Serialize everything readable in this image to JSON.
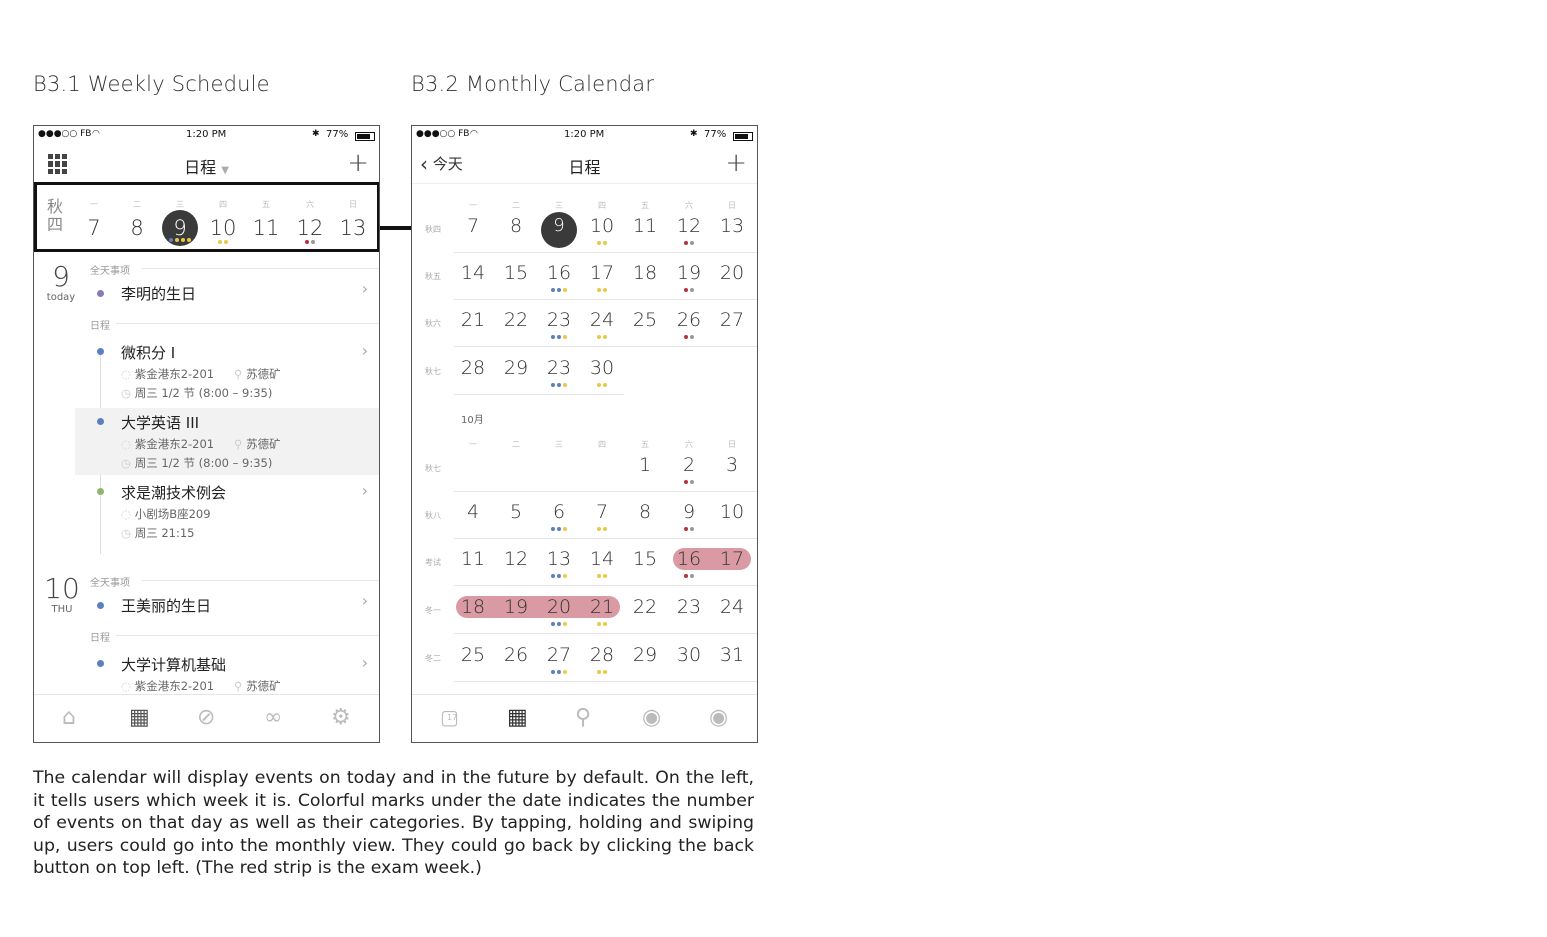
{
  "titles": {
    "left": "B3.1 Weekly Schedule",
    "right": "B3.2 Monthly Calendar"
  },
  "status": {
    "carrier": "●●●○○ FB",
    "time": "1:20 PM",
    "battery": "77%"
  },
  "colors": {
    "purple": "#8a7bb5",
    "blue": "#5b7fbf",
    "green": "#8fb56b",
    "yellow": "#e8c94a",
    "red": "#b5323c",
    "gray": "#999999",
    "exam": "#d99aa3",
    "today": "#3a3a3a"
  },
  "weekly": {
    "nav": {
      "title": "日程",
      "menu_icon": "grid-icon",
      "add": "+",
      "dropdown": "▼"
    },
    "week_label": [
      "秋",
      "四"
    ],
    "weekday_heads": [
      "一",
      "二",
      "三",
      "四",
      "五",
      "六",
      "日"
    ],
    "days": [
      {
        "num": "7",
        "dots": []
      },
      {
        "num": "8",
        "dots": []
      },
      {
        "num": "9",
        "dots": [
          "blue",
          "yellow",
          "yellow",
          "yellow"
        ],
        "today": true
      },
      {
        "num": "10",
        "dots": [
          "yellow",
          "yellow"
        ]
      },
      {
        "num": "11",
        "dots": []
      },
      {
        "num": "12",
        "dots": [
          "red",
          "gray"
        ]
      },
      {
        "num": "13",
        "dots": []
      }
    ],
    "day1": {
      "num": "9",
      "sub": "today",
      "allday_label": "全天事项",
      "allday_event": "李明的生日",
      "schedule_label": "日程",
      "events": [
        {
          "title": "微积分 I",
          "place": "紫金港东2-201",
          "person": "苏德矿",
          "time": "周三 1/2 节 (8:00 – 9:35)"
        },
        {
          "title": "大学英语 III",
          "place": "紫金港东2-201",
          "person": "苏德矿",
          "time": "周三 1/2 节 (8:00 – 9:35)"
        },
        {
          "title": "求是潮技术例会",
          "place": "小剧场B座209",
          "time": "周三 21:15"
        }
      ]
    },
    "day2": {
      "num": "10",
      "sub": "THU",
      "allday_label": "全天事项",
      "allday_event": "王美丽的生日",
      "schedule_label": "日程",
      "events": [
        {
          "title": "大学计算机基础",
          "place": "紫金港东2-201",
          "person": "苏德矿"
        }
      ]
    }
  },
  "monthly": {
    "nav": {
      "back": "今天",
      "title": "日程",
      "add": "+"
    },
    "weekday_heads": [
      "一",
      "二",
      "三",
      "四",
      "五",
      "六",
      "日"
    ],
    "sep_rows": [
      {
        "label": "秋四",
        "days": [
          "7",
          "8",
          "9",
          "10",
          "11",
          "12",
          "13"
        ]
      },
      {
        "label": "秋五",
        "days": [
          "14",
          "15",
          "16",
          "17",
          "18",
          "19",
          "20"
        ]
      },
      {
        "label": "秋六",
        "days": [
          "21",
          "22",
          "23",
          "24",
          "25",
          "26",
          "27"
        ]
      },
      {
        "label": "秋七",
        "days": [
          "28",
          "29",
          "23",
          "30"
        ]
      }
    ],
    "month2_label": "10月",
    "oct_rows": [
      {
        "label": "秋七",
        "days": [
          "",
          "",
          "",
          "",
          "1",
          "2",
          "3"
        ]
      },
      {
        "label": "秋八",
        "days": [
          "4",
          "5",
          "6",
          "7",
          "8",
          "9",
          "10"
        ]
      },
      {
        "label": "考试",
        "days": [
          "11",
          "12",
          "13",
          "14",
          "15",
          "16",
          "17"
        ]
      },
      {
        "label": "冬一",
        "days": [
          "18",
          "19",
          "20",
          "21",
          "22",
          "23",
          "24"
        ]
      },
      {
        "label": "冬二",
        "days": [
          "25",
          "26",
          "27",
          "28",
          "29",
          "30",
          "31"
        ]
      }
    ],
    "tab_date": "17"
  },
  "description": "The calendar will display events on today and in the future by default. On the left, it tells users which week it is. Colorful marks under the date indicates the number of events on that day as well as their categories. By tapping, holding and swiping up, users could go into the monthly view. They could go back by clicking the back button on top left. (The red strip is the exam week.)"
}
